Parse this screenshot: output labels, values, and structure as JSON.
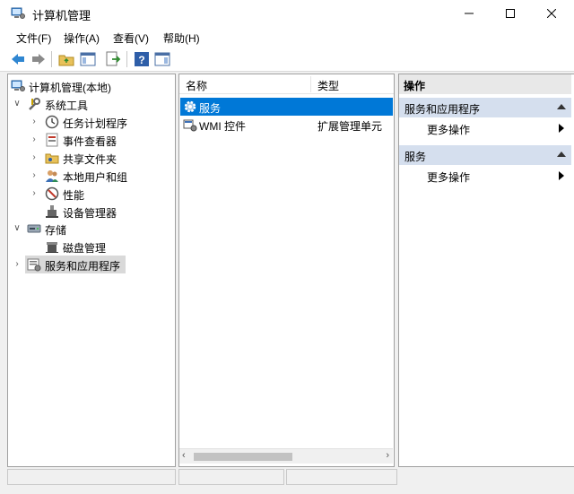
{
  "window": {
    "title": "计算机管理",
    "controls": {
      "minimize": "minimize",
      "maximize": "maximize",
      "close": "close"
    }
  },
  "menu": [
    {
      "label": "文件(F)"
    },
    {
      "label": "操作(A)"
    },
    {
      "label": "查看(V)"
    },
    {
      "label": "帮助(H)"
    }
  ],
  "toolbar": {
    "buttons": [
      "back-icon",
      "forward-icon",
      "up-folder-icon",
      "show-hide-tree-icon",
      "export-list-icon",
      "help-icon",
      "show-hide-action-pane-icon"
    ]
  },
  "tree": {
    "root": "计算机管理(本地)",
    "system_tools": "系统工具",
    "task_scheduler": "任务计划程序",
    "event_viewer": "事件查看器",
    "shared_folders": "共享文件夹",
    "local_users": "本地用户和组",
    "performance": "性能",
    "device_manager": "设备管理器",
    "storage": "存储",
    "disk_management": "磁盘管理",
    "services_apps": "服务和应用程序"
  },
  "list": {
    "headers": {
      "name": "名称",
      "type": "类型"
    },
    "rows": [
      {
        "name": "服务",
        "type": "",
        "selected": true
      },
      {
        "name": "WMI 控件",
        "type": "扩展管理单元",
        "selected": false
      }
    ]
  },
  "actions": {
    "header": "操作",
    "section1": "服务和应用程序",
    "item1": "更多操作",
    "section2": "服务",
    "item2": "更多操作"
  },
  "colors": {
    "selection": "#0078d7",
    "action_section_bg": "#d5dfee",
    "workarea_bg": "#f0f0f0"
  }
}
